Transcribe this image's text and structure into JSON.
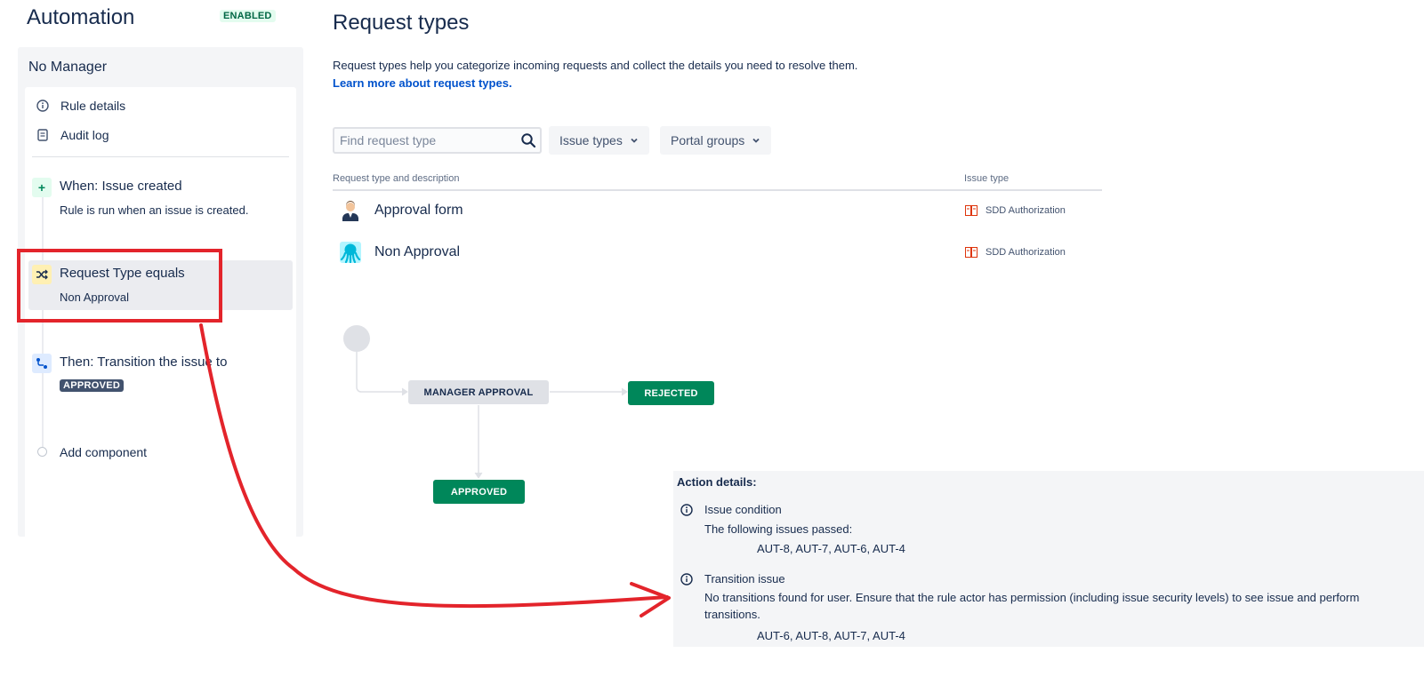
{
  "automation": {
    "title": "Automation",
    "status_badge": "ENABLED",
    "rule_name": "No Manager",
    "menu": [
      {
        "label": "Rule details",
        "icon": "info-icon"
      },
      {
        "label": "Audit log",
        "icon": "document-icon"
      }
    ],
    "steps": {
      "trigger": {
        "title": "When: Issue created",
        "subtitle": "Rule is run when an issue is created.",
        "icon": "plus-icon"
      },
      "condition": {
        "title": "Request Type equals",
        "subtitle": "Non Approval",
        "icon": "shuffle-icon"
      },
      "action": {
        "title": "Then: Transition the issue to",
        "status": "APPROVED",
        "icon": "transition-icon"
      },
      "add": {
        "label": "Add component"
      }
    }
  },
  "request_types": {
    "title": "Request types",
    "description": "Request types help you categorize incoming requests and collect the details you need to resolve them.",
    "learn_more": "Learn more about request types.",
    "search_placeholder": "Find request type",
    "filters": [
      "Issue types",
      "Portal groups"
    ],
    "columns": [
      "Request type and description",
      "Issue type"
    ],
    "rows": [
      {
        "name": "Approval form",
        "issue_type": "SDD Authorization",
        "avatar": "person-avatar"
      },
      {
        "name": "Non Approval",
        "issue_type": "SDD Authorization",
        "avatar": "octopus-avatar"
      }
    ]
  },
  "workflow": {
    "statuses": [
      "MANAGER APPROVAL",
      "REJECTED",
      "APPROVED"
    ]
  },
  "action_details": {
    "title": "Action details:",
    "items": [
      {
        "heading": "Issue condition",
        "text": "The following issues passed:",
        "issues": "AUT-8, AUT-7, AUT-6, AUT-4"
      },
      {
        "heading": "Transition issue",
        "text": "No transitions found for user. Ensure that the rule actor has permission (including issue security levels) to see issue and perform transitions.",
        "issues": "AUT-6, AUT-8, AUT-7, AUT-4"
      }
    ]
  },
  "colors": {
    "annotation": "#e3242b",
    "success": "#00875a",
    "link": "#0052cc"
  }
}
